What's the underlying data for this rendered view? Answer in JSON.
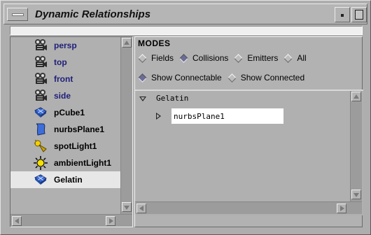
{
  "window": {
    "title": "Dynamic Relationships"
  },
  "outliner": {
    "nodes": [
      {
        "label": "persp",
        "icon": "camera-icon",
        "kind": "camera"
      },
      {
        "label": "top",
        "icon": "camera-icon",
        "kind": "camera"
      },
      {
        "label": "front",
        "icon": "camera-icon",
        "kind": "camera"
      },
      {
        "label": "side",
        "icon": "camera-icon",
        "kind": "camera"
      },
      {
        "label": "pCube1",
        "icon": "poly-mesh-icon",
        "kind": "obj"
      },
      {
        "label": "nurbsPlane1",
        "icon": "nurbs-surface-icon",
        "kind": "obj"
      },
      {
        "label": "spotLight1",
        "icon": "spotlight-icon",
        "kind": "obj"
      },
      {
        "label": "ambientLight1",
        "icon": "ambient-light-icon",
        "kind": "obj"
      },
      {
        "label": "Gelatin",
        "icon": "poly-mesh-icon",
        "kind": "obj",
        "selected": true
      }
    ]
  },
  "modes": {
    "title": "MODES",
    "filters": [
      {
        "label": "Fields",
        "selected": false
      },
      {
        "label": "Collisions",
        "selected": true
      },
      {
        "label": "Emitters",
        "selected": false
      },
      {
        "label": "All",
        "selected": false
      }
    ],
    "show": [
      {
        "label": "Show Connectable",
        "selected": true
      },
      {
        "label": "Show Connected",
        "selected": false
      }
    ]
  },
  "tree": {
    "root": {
      "label": "Gelatin",
      "expanded": true
    },
    "children": [
      {
        "label": "nurbsPlane1",
        "expanded": false
      }
    ]
  },
  "colors": {
    "window_bg": "#aeaeae",
    "camera_label": "#1f1f7a",
    "selection_bg": "#e7e7e7",
    "radio_on": "#6c6c9a"
  }
}
